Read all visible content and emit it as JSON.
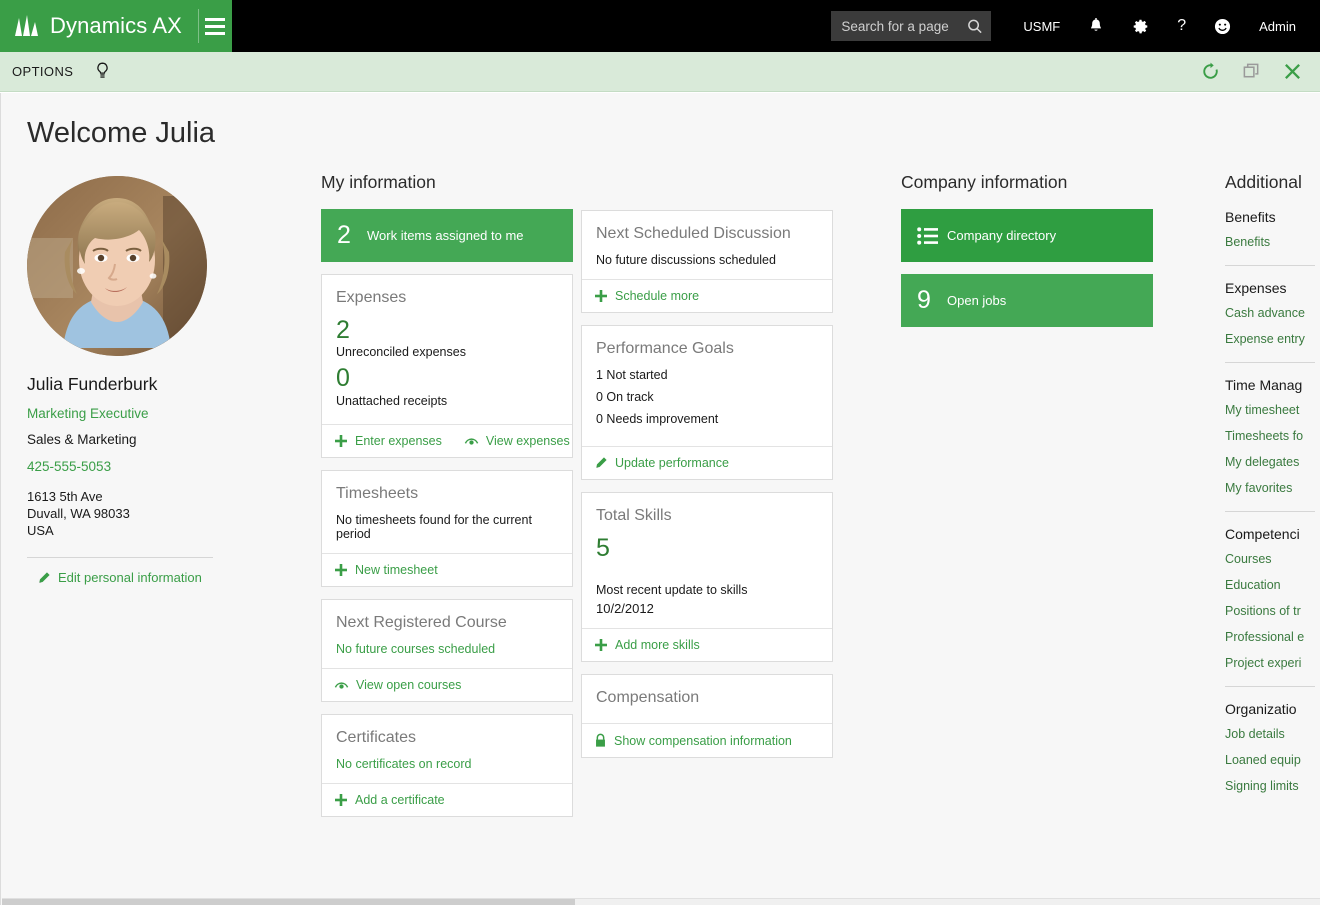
{
  "topbar": {
    "brand": "Dynamics AX",
    "menu_icon": "hamburger-icon",
    "search_placeholder": "Search for a page",
    "search_value": "",
    "company": "USMF",
    "notifications_icon": "bell-icon",
    "settings_icon": "gear-icon",
    "help_icon": "question-mark-icon",
    "feedback_icon": "smiley-face-icon",
    "user": "Admin"
  },
  "optionsbar": {
    "options_label": "OPTIONS",
    "bulb_icon": "lightbulb-icon",
    "refresh_icon": "refresh-icon",
    "restore_icon": "restore-window-icon",
    "close_icon": "close-icon"
  },
  "page": {
    "title": "Welcome Julia"
  },
  "profile": {
    "name": "Julia Funderburk",
    "title": "Marketing Executive",
    "department": "Sales & Marketing",
    "phone": "425-555-5053",
    "address_line1": "1613 5th Ave",
    "address_line2": "Duvall, WA 98033",
    "address_line3": "USA",
    "edit_link": "Edit personal information"
  },
  "my_information": {
    "heading": "My information",
    "work_items": {
      "count": "2",
      "label": "Work items assigned to me"
    },
    "expenses": {
      "title": "Expenses",
      "unreconciled_count": "2",
      "unreconciled_label": "Unreconciled expenses",
      "unattached_count": "0",
      "unattached_label": "Unattached receipts",
      "action_enter": "Enter expenses",
      "action_view": "View expenses"
    },
    "timesheets": {
      "title": "Timesheets",
      "empty": "No timesheets found for the current period",
      "action_new": "New timesheet"
    },
    "next_course": {
      "title": "Next Registered Course",
      "empty": "No future courses scheduled",
      "action_view": "View open courses"
    },
    "certificates": {
      "title": "Certificates",
      "empty": "No certificates on record",
      "action_add": "Add a certificate"
    },
    "next_discussion": {
      "title": "Next Scheduled Discussion",
      "empty": "No future discussions scheduled",
      "action_schedule": "Schedule more"
    },
    "performance_goals": {
      "title": "Performance Goals",
      "not_started": "1 Not started",
      "on_track": "0 On track",
      "needs_improvement": "0 Needs improvement",
      "action_update": "Update performance"
    },
    "total_skills": {
      "title": "Total Skills",
      "count": "5",
      "recent_label": "Most recent update to skills",
      "recent_date": "10/2/2012",
      "action_add": "Add more skills"
    },
    "compensation": {
      "title": "Compensation",
      "action_show": "Show compensation information"
    }
  },
  "company_information": {
    "heading": "Company information",
    "directory": {
      "label": "Company directory",
      "icon": "bulleted-list-icon"
    },
    "open_jobs": {
      "count": "9",
      "label": "Open jobs"
    }
  },
  "additional": {
    "heading": "Additional",
    "groups": [
      {
        "title": "Benefits",
        "items": [
          "Benefits"
        ]
      },
      {
        "title": "Expenses",
        "items": [
          "Cash advance",
          "Expense entry"
        ]
      },
      {
        "title": "Time Manag",
        "items": [
          "My timesheet",
          "Timesheets fo",
          "My delegates",
          "My favorites"
        ]
      },
      {
        "title": "Competenci",
        "items": [
          "Courses",
          "Education",
          "Positions of tr",
          "Professional e",
          "Project experi"
        ]
      },
      {
        "title": "Organizatio",
        "items": [
          "Job details",
          "Loaned equip",
          "Signing limits"
        ]
      }
    ]
  },
  "colors": {
    "brand_green": "#3a9e47",
    "tile_green": "#44a855",
    "tile_green_dark": "#2f9e41",
    "options_bar": "#d9ead9",
    "link_green": "#3a7a3f",
    "number_green": "#2e7d32"
  }
}
